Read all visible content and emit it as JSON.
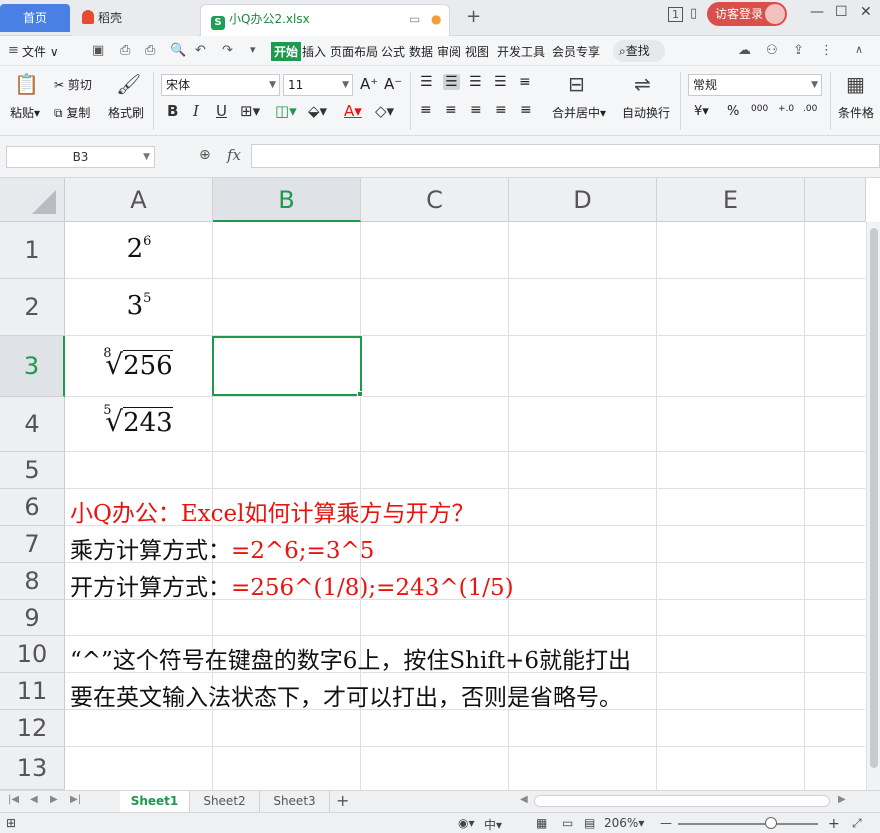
{
  "tabs": {
    "home": "首页",
    "daoke": "稻壳",
    "doc": "小Q办公2.xlsx"
  },
  "titlebar": {
    "login": "访客登录",
    "page_indicator": "1"
  },
  "menu": {
    "file": "文件",
    "items": [
      "开始",
      "插入",
      "页面布局",
      "公式",
      "数据",
      "审阅",
      "视图",
      "开发工具",
      "会员专享"
    ],
    "search": "查找"
  },
  "ribbon": {
    "paste": "粘贴",
    "cut": "剪切",
    "copy": "复制",
    "format_painter": "格式刷",
    "font_name": "宋体",
    "font_size": "11",
    "merge": "合并居中",
    "wrap": "自动换行",
    "number_format": "常规",
    "cond_format": "条件格"
  },
  "formula_bar": {
    "name_box": "B3",
    "fx": "fx",
    "value": ""
  },
  "grid": {
    "columns": [
      "A",
      "B",
      "C",
      "D",
      "E"
    ],
    "active_column": "B",
    "rows": [
      "1",
      "2",
      "3",
      "4",
      "5",
      "6",
      "7",
      "8",
      "9",
      "10",
      "11",
      "12",
      "13"
    ],
    "active_row": "3",
    "cells": {
      "a1_base": "2",
      "a1_exp": "6",
      "a2_base": "3",
      "a2_exp": "5",
      "a3_index": "8",
      "a3_radicand": "256",
      "a4_index": "5",
      "a4_radicand": "243",
      "row6": "小Q办公：Excel如何计算乘方与开方？",
      "row7_label": "乘方计算方式：",
      "row7_formula": "=2^6;=3^5",
      "row8_label": "开方计算方式：",
      "row8_formula": "=256^(1/8);=243^(1/5)",
      "row10": "“^”这个符号在键盘的数字6上，按住Shift+6就能打出",
      "row11": "要在英文输入法状态下，才可以打出，否则是省略号。"
    },
    "colors": {
      "red": "#e8140f",
      "accent": "#1d9a4e"
    }
  },
  "sheets": [
    "Sheet1",
    "Sheet2",
    "Sheet3"
  ],
  "active_sheet": "Sheet1",
  "status": {
    "zoom": "206%"
  }
}
